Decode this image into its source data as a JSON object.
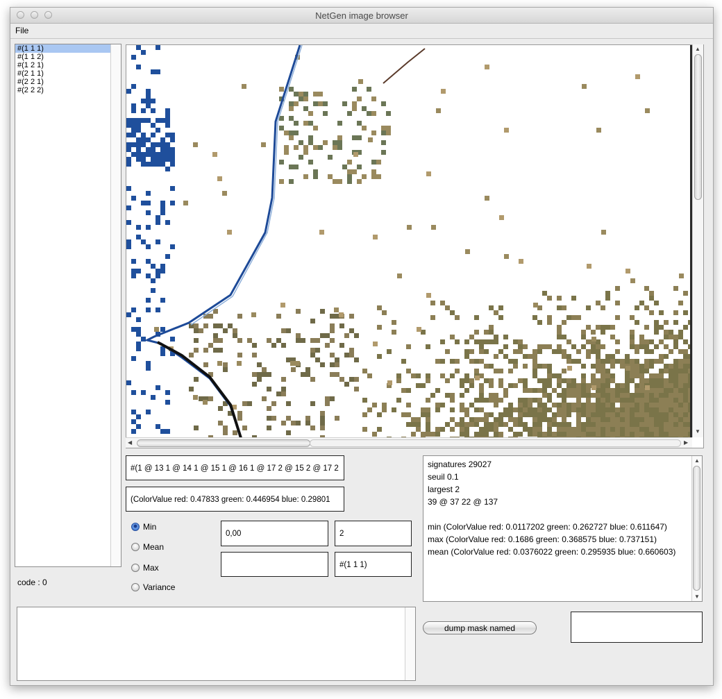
{
  "window": {
    "title": "NetGen image browser"
  },
  "menubar": {
    "file_label": "File"
  },
  "mask_list": {
    "items": [
      "#(1 1 1)",
      "#(1 1 2)",
      "#(1 2 1)",
      "#(2 1 1)",
      "#(2 2 1)",
      "#(2 2 2)"
    ],
    "selected_index": 0
  },
  "status": {
    "code": "code : 0"
  },
  "image_view": {
    "description_icon": "satellite-image",
    "vertical_scroll": 0.1,
    "horizontal_scroll": 0.0
  },
  "fields": {
    "signature_path": "#(1 @ 13 1 @ 14 1 @ 15 1 @ 16 1 @ 17 2 @ 15 2 @ 17 2",
    "color_value": "(ColorValue red: 0.47833 green: 0.446954 blue: 0.29801",
    "threshold": "0,00",
    "largest": "2",
    "lower_left": "",
    "mask_id": "#(1 1 1)"
  },
  "stat_mode": {
    "options": [
      "Min",
      "Mean",
      "Max",
      "Variance"
    ],
    "selected": "Min"
  },
  "stats": {
    "lines": [
      "signatures  29027",
      "seuil  0.1",
      "largest  2",
      "39 @ 37 22 @ 137",
      "",
      "min (ColorValue red: 0.0117202 green: 0.262727 blue: 0.611647)",
      "max (ColorValue red: 0.1686 green: 0.368575 blue: 0.737151)",
      "mean (ColorValue red: 0.0376022 green: 0.295935 blue: 0.660603)"
    ]
  },
  "dump": {
    "button_label": "dump mask named",
    "name_value": ""
  },
  "log": {
    "text": ""
  },
  "colors": {
    "water": "#1f4f9c",
    "land": "#8a7d58",
    "selection": "#a9c7f2"
  }
}
